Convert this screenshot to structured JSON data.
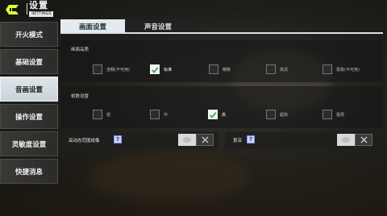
{
  "header": {
    "title": "设置",
    "subtitle": "SETTINGS"
  },
  "sidebar": {
    "items": [
      {
        "label": "开火模式"
      },
      {
        "label": "基础设置"
      },
      {
        "label": "音画设置"
      },
      {
        "label": "操作设置"
      },
      {
        "label": "灵敏度设置"
      },
      {
        "label": "快捷消息"
      }
    ],
    "active_index": 2
  },
  "tabs": [
    {
      "label": "画面设置",
      "active": true
    },
    {
      "label": "声音设置",
      "active": false
    }
  ],
  "picture_quality": {
    "label": "画面品质",
    "options": [
      {
        "label": "流畅(不可用)",
        "checked": false
      },
      {
        "label": "标准",
        "checked": true
      },
      {
        "label": "精致",
        "checked": false
      },
      {
        "label": "高清",
        "checked": false
      },
      {
        "label": "极致(不可用)",
        "checked": false
      }
    ]
  },
  "frame_rate": {
    "label": "帧数设置",
    "options": [
      {
        "label": "低",
        "checked": false
      },
      {
        "label": "中",
        "checked": false
      },
      {
        "label": "高",
        "checked": true
      },
      {
        "label": "超高",
        "checked": false
      },
      {
        "label": "极限",
        "checked": false
      }
    ]
  },
  "toggles": [
    {
      "label": "高动态范围成像",
      "help": "?"
    },
    {
      "label": "景深",
      "help": "?"
    }
  ],
  "colors": {
    "accent_check": "#2fb14a",
    "active_tab": "#e3ebef",
    "help_icon": "#c8d0ff"
  }
}
